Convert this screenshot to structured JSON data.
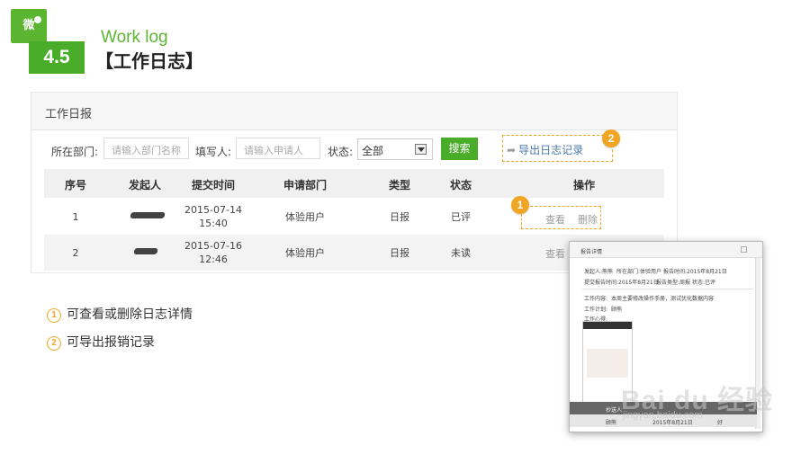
{
  "header": {
    "logo_text": "微",
    "section_number": "4.5",
    "title_en": "Work log",
    "title_cn": "【工作日志】"
  },
  "panel": {
    "title": "工作日报",
    "filters": {
      "dept_label": "所在部门:",
      "dept_placeholder": "请输入部门名称",
      "author_label": "填写人:",
      "author_placeholder": "请输入申请人",
      "status_label": "状态:",
      "status_value": "全部",
      "search_label": "搜索",
      "export_label": "导出日志记录"
    },
    "columns": [
      "序号",
      "发起人",
      "提交时间",
      "申请部门",
      "类型",
      "状态",
      "操作"
    ],
    "rows": [
      {
        "index": "1",
        "date": "2015-07-14",
        "time": "15:40",
        "dept": "体验用户",
        "type": "日报",
        "status": "已评",
        "view": "查看",
        "delete": "删除"
      },
      {
        "index": "2",
        "date": "2015-07-16",
        "time": "12:46",
        "dept": "体验用户",
        "type": "日报",
        "status": "未读",
        "view": "查看"
      }
    ]
  },
  "callouts": [
    "1",
    "2"
  ],
  "notes": [
    {
      "num": "1",
      "text": "可查看或删除日志详情"
    },
    {
      "num": "2",
      "text": "可导出报销记录"
    }
  ],
  "popup": {
    "title": "报告详情",
    "line1a": "发起人:熊熊",
    "line1b": "所在部门:体验用户",
    "line1c": "报告时间:2015年8月21日",
    "line2a": "提交报告时间:2015年8月21日",
    "line2b": "报告类型:周报",
    "line2c": "状态:已评",
    "content_label": "工作内容:",
    "content_value": "本周主要修改操作手册，测试优化数据内容",
    "plan_label": "工作计划:",
    "plan_value": "顾熊",
    "feel_label": "工作心得:",
    "bottom_label": "抄送人",
    "footer_a": "顾熊",
    "footer_b": "2015年8月21日",
    "footer_c": "好"
  },
  "watermark": {
    "brand": "Bai du 经验",
    "url": "jingyan.baidu.com"
  },
  "colors": {
    "brand_green": "#4aad2a",
    "callout_orange": "#f0a623",
    "link_blue": "#4a79a8"
  }
}
